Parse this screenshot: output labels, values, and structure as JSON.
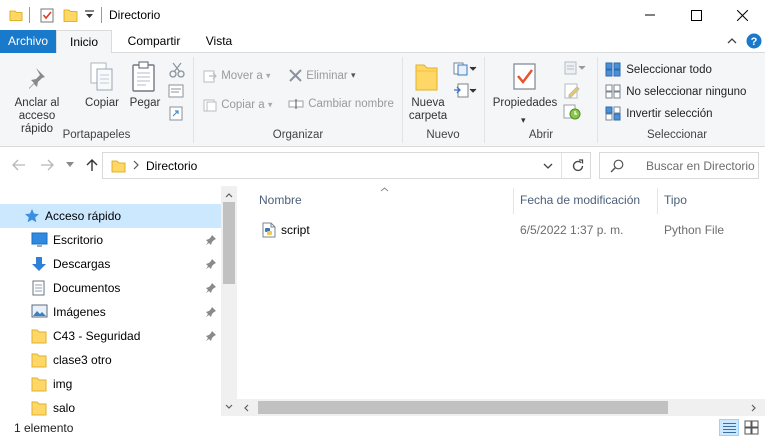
{
  "window": {
    "title": "Directorio",
    "qat_dropdown_icon": "chevron-down-icon",
    "minimize_icon": "minimize-icon",
    "maximize_icon": "maximize-icon",
    "close_icon": "close-icon"
  },
  "ribbon_tabs": {
    "archivo": "Archivo",
    "inicio": "Inicio",
    "compartir": "Compartir",
    "vista": "Vista",
    "active": "Inicio"
  },
  "ribbon": {
    "portapapeles": {
      "label": "Portapapeles",
      "anclar_line1": "Anclar al",
      "anclar_line2": "acceso rápido",
      "copiar": "Copiar",
      "pegar": "Pegar"
    },
    "organizar": {
      "label": "Organizar",
      "mover_a": "Mover a",
      "copiar_a": "Copiar a",
      "eliminar": "Eliminar",
      "cambiar_nombre": "Cambiar nombre"
    },
    "nuevo": {
      "label": "Nuevo",
      "nueva_line1": "Nueva",
      "nueva_line2": "carpeta"
    },
    "abrir": {
      "label": "Abrir",
      "propiedades": "Propiedades"
    },
    "seleccionar": {
      "label": "Seleccionar",
      "seleccionar_todo": "Seleccionar todo",
      "no_seleccionar": "No seleccionar ninguno",
      "invertir": "Invertir selección"
    }
  },
  "address": {
    "path": "Directorio",
    "search_placeholder": "Buscar en Directorio"
  },
  "nav_pane": {
    "quick_access": "Acceso rápido",
    "items": [
      {
        "label": "Escritorio",
        "pinned": true,
        "icon": "desktop-icon"
      },
      {
        "label": "Descargas",
        "pinned": true,
        "icon": "download-icon"
      },
      {
        "label": "Documentos",
        "pinned": true,
        "icon": "document-icon"
      },
      {
        "label": "Imágenes",
        "pinned": true,
        "icon": "pictures-icon"
      },
      {
        "label": "C43 - Seguridad",
        "pinned": true,
        "icon": "folder-icon"
      },
      {
        "label": "clase3 otro",
        "pinned": false,
        "icon": "folder-icon"
      },
      {
        "label": "img",
        "pinned": false,
        "icon": "folder-icon"
      },
      {
        "label": "salo",
        "pinned": false,
        "icon": "folder-icon"
      }
    ]
  },
  "file_list": {
    "columns": [
      "Nombre",
      "Fecha de modificación",
      "Tipo"
    ],
    "rows": [
      {
        "name": "script",
        "modified": "6/5/2022 1:37 p. m.",
        "type": "Python File",
        "icon": "python-file-icon"
      }
    ]
  },
  "status_bar": {
    "item_count": "1 elemento"
  },
  "colors": {
    "accent": "#1979ca",
    "selection": "#cce8ff",
    "folder": "#ffd766"
  }
}
